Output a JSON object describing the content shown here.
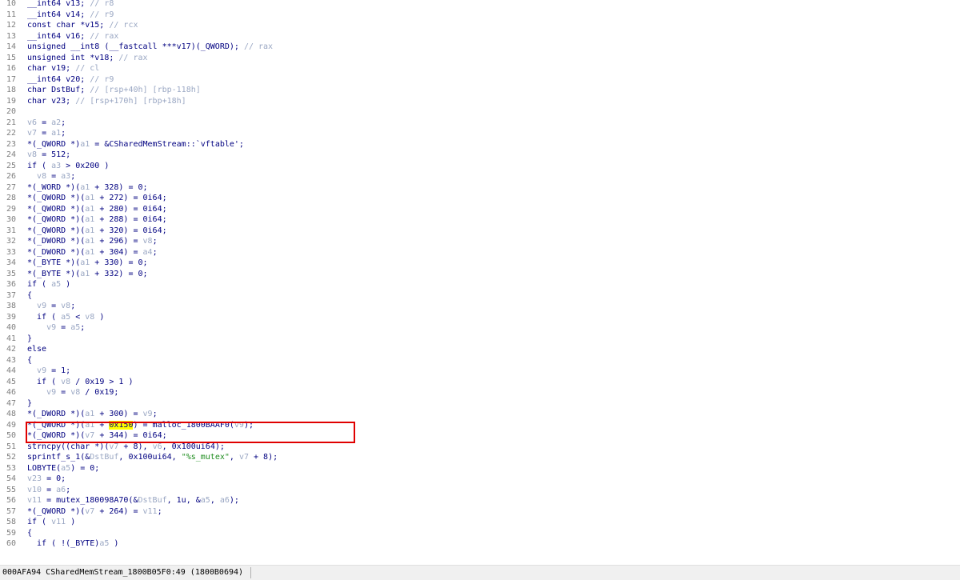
{
  "editor": {
    "lines": [
      {
        "n": "10",
        "segs": [
          [
            "k",
            "__int64 v13; "
          ],
          [
            "c",
            "// r8"
          ]
        ]
      },
      {
        "n": "11",
        "segs": [
          [
            "k",
            "__int64 v14; "
          ],
          [
            "c",
            "// r9"
          ]
        ]
      },
      {
        "n": "12",
        "segs": [
          [
            "k",
            "const char *v15; "
          ],
          [
            "c",
            "// rcx"
          ]
        ]
      },
      {
        "n": "13",
        "segs": [
          [
            "k",
            "__int64 v16; "
          ],
          [
            "c",
            "// rax"
          ]
        ]
      },
      {
        "n": "14",
        "segs": [
          [
            "k",
            "unsigned __int8 (__fastcall ***v17)(_QWORD); "
          ],
          [
            "c",
            "// rax"
          ]
        ]
      },
      {
        "n": "15",
        "segs": [
          [
            "k",
            "unsigned int *v18; "
          ],
          [
            "c",
            "// rax"
          ]
        ]
      },
      {
        "n": "16",
        "segs": [
          [
            "k",
            "char v19; "
          ],
          [
            "c",
            "// cl"
          ]
        ]
      },
      {
        "n": "17",
        "segs": [
          [
            "k",
            "__int64 v20; "
          ],
          [
            "c",
            "// r9"
          ]
        ]
      },
      {
        "n": "18",
        "segs": [
          [
            "k",
            "char DstBuf; "
          ],
          [
            "c",
            "// [rsp+40h] [rbp-118h]"
          ]
        ]
      },
      {
        "n": "19",
        "segs": [
          [
            "k",
            "char v23; "
          ],
          [
            "c",
            "// [rsp+170h] [rbp+18h]"
          ]
        ]
      },
      {
        "n": "20",
        "segs": []
      },
      {
        "n": "21",
        "segs": [
          [
            "v",
            "v6"
          ],
          [
            "k",
            " = "
          ],
          [
            "v",
            "a2"
          ],
          [
            "k",
            ";"
          ]
        ]
      },
      {
        "n": "22",
        "segs": [
          [
            "v",
            "v7"
          ],
          [
            "k",
            " = "
          ],
          [
            "v",
            "a1"
          ],
          [
            "k",
            ";"
          ]
        ]
      },
      {
        "n": "23",
        "segs": [
          [
            "k",
            "*(_QWORD *)"
          ],
          [
            "v",
            "a1"
          ],
          [
            "k",
            " = &CSharedMemStream::`vftable';"
          ]
        ]
      },
      {
        "n": "24",
        "segs": [
          [
            "v",
            "v8"
          ],
          [
            "k",
            " = 512;"
          ]
        ]
      },
      {
        "n": "25",
        "segs": [
          [
            "k",
            "if ( "
          ],
          [
            "v",
            "a3"
          ],
          [
            "k",
            " > 0x200 )"
          ]
        ]
      },
      {
        "n": "26",
        "segs": [
          [
            "k",
            "  "
          ],
          [
            "v",
            "v8"
          ],
          [
            "k",
            " = "
          ],
          [
            "v",
            "a3"
          ],
          [
            "k",
            ";"
          ]
        ]
      },
      {
        "n": "27",
        "segs": [
          [
            "k",
            "*(_WORD *)("
          ],
          [
            "v",
            "a1"
          ],
          [
            "k",
            " + 328) = 0;"
          ]
        ]
      },
      {
        "n": "28",
        "segs": [
          [
            "k",
            "*(_QWORD *)("
          ],
          [
            "v",
            "a1"
          ],
          [
            "k",
            " + 272) = 0i64;"
          ]
        ]
      },
      {
        "n": "29",
        "segs": [
          [
            "k",
            "*(_QWORD *)("
          ],
          [
            "v",
            "a1"
          ],
          [
            "k",
            " + 280) = 0i64;"
          ]
        ]
      },
      {
        "n": "30",
        "segs": [
          [
            "k",
            "*(_QWORD *)("
          ],
          [
            "v",
            "a1"
          ],
          [
            "k",
            " + 288) = 0i64;"
          ]
        ]
      },
      {
        "n": "31",
        "segs": [
          [
            "k",
            "*(_QWORD *)("
          ],
          [
            "v",
            "a1"
          ],
          [
            "k",
            " + 320) = 0i64;"
          ]
        ]
      },
      {
        "n": "32",
        "segs": [
          [
            "k",
            "*(_DWORD *)("
          ],
          [
            "v",
            "a1"
          ],
          [
            "k",
            " + 296) = "
          ],
          [
            "v",
            "v8"
          ],
          [
            "k",
            ";"
          ]
        ]
      },
      {
        "n": "33",
        "segs": [
          [
            "k",
            "*(_DWORD *)("
          ],
          [
            "v",
            "a1"
          ],
          [
            "k",
            " + 304) = "
          ],
          [
            "v",
            "a4"
          ],
          [
            "k",
            ";"
          ]
        ]
      },
      {
        "n": "34",
        "segs": [
          [
            "k",
            "*(_BYTE *)("
          ],
          [
            "v",
            "a1"
          ],
          [
            "k",
            " + 330) = 0;"
          ]
        ]
      },
      {
        "n": "35",
        "segs": [
          [
            "k",
            "*(_BYTE *)("
          ],
          [
            "v",
            "a1"
          ],
          [
            "k",
            " + 332) = 0;"
          ]
        ]
      },
      {
        "n": "36",
        "segs": [
          [
            "k",
            "if ( "
          ],
          [
            "v",
            "a5"
          ],
          [
            "k",
            " )"
          ]
        ]
      },
      {
        "n": "37",
        "segs": [
          [
            "k",
            "{"
          ]
        ]
      },
      {
        "n": "38",
        "segs": [
          [
            "k",
            "  "
          ],
          [
            "v",
            "v9"
          ],
          [
            "k",
            " = "
          ],
          [
            "v",
            "v8"
          ],
          [
            "k",
            ";"
          ]
        ]
      },
      {
        "n": "39",
        "segs": [
          [
            "k",
            "  if ( "
          ],
          [
            "v",
            "a5"
          ],
          [
            "k",
            " < "
          ],
          [
            "v",
            "v8"
          ],
          [
            "k",
            " )"
          ]
        ]
      },
      {
        "n": "40",
        "segs": [
          [
            "k",
            "    "
          ],
          [
            "v",
            "v9"
          ],
          [
            "k",
            " = "
          ],
          [
            "v",
            "a5"
          ],
          [
            "k",
            ";"
          ]
        ]
      },
      {
        "n": "41",
        "segs": [
          [
            "k",
            "}"
          ]
        ]
      },
      {
        "n": "42",
        "segs": [
          [
            "k",
            "else"
          ]
        ]
      },
      {
        "n": "43",
        "segs": [
          [
            "k",
            "{"
          ]
        ]
      },
      {
        "n": "44",
        "segs": [
          [
            "k",
            "  "
          ],
          [
            "v",
            "v9"
          ],
          [
            "k",
            " = 1;"
          ]
        ]
      },
      {
        "n": "45",
        "segs": [
          [
            "k",
            "  if ( "
          ],
          [
            "v",
            "v8"
          ],
          [
            "k",
            " / 0x19 > 1 )"
          ]
        ]
      },
      {
        "n": "46",
        "segs": [
          [
            "k",
            "    "
          ],
          [
            "v",
            "v9"
          ],
          [
            "k",
            " = "
          ],
          [
            "v",
            "v8"
          ],
          [
            "k",
            " / 0x19;"
          ]
        ]
      },
      {
        "n": "47",
        "segs": [
          [
            "k",
            "}"
          ]
        ]
      },
      {
        "n": "48",
        "segs": [
          [
            "k",
            "*(_DWORD *)("
          ],
          [
            "v",
            "a1"
          ],
          [
            "k",
            " + 300) = "
          ],
          [
            "v",
            "v9"
          ],
          [
            "k",
            ";"
          ]
        ]
      },
      {
        "n": "49",
        "segs": [
          [
            "k",
            "*(_QWORD *)("
          ],
          [
            "v",
            "a1"
          ],
          [
            "k",
            " + "
          ],
          [
            "h",
            "0x150"
          ],
          [
            "k",
            ") = malloc_1800BAAF0("
          ],
          [
            "v",
            "v9"
          ],
          [
            "k",
            ");"
          ]
        ]
      },
      {
        "n": "50",
        "segs": [
          [
            "k",
            "*(_QWORD *)("
          ],
          [
            "v",
            "v7"
          ],
          [
            "k",
            " + 344) = 0i64;"
          ]
        ]
      },
      {
        "n": "51",
        "segs": [
          [
            "k",
            "strncpy((char *)("
          ],
          [
            "v",
            "v7"
          ],
          [
            "k",
            " + 8), "
          ],
          [
            "v",
            "v6"
          ],
          [
            "k",
            ", 0x100ui64);"
          ]
        ]
      },
      {
        "n": "52",
        "segs": [
          [
            "k",
            "sprintf_s_1(&"
          ],
          [
            "v",
            "DstBuf"
          ],
          [
            "k",
            ", 0x100ui64, "
          ],
          [
            "s",
            "\"%s_mutex\""
          ],
          [
            "k",
            ", "
          ],
          [
            "v",
            "v7"
          ],
          [
            "k",
            " + 8);"
          ]
        ]
      },
      {
        "n": "53",
        "segs": [
          [
            "k",
            "LOBYTE("
          ],
          [
            "v",
            "a5"
          ],
          [
            "k",
            ") = 0;"
          ]
        ]
      },
      {
        "n": "54",
        "segs": [
          [
            "v",
            "v23"
          ],
          [
            "k",
            " = 0;"
          ]
        ]
      },
      {
        "n": "55",
        "segs": [
          [
            "v",
            "v10"
          ],
          [
            "k",
            " = "
          ],
          [
            "v",
            "a6"
          ],
          [
            "k",
            ";"
          ]
        ]
      },
      {
        "n": "56",
        "segs": [
          [
            "v",
            "v11"
          ],
          [
            "k",
            " = mutex_180098A70(&"
          ],
          [
            "v",
            "DstBuf"
          ],
          [
            "k",
            ", 1u, &"
          ],
          [
            "v",
            "a5"
          ],
          [
            "k",
            ", "
          ],
          [
            "v",
            "a6"
          ],
          [
            "k",
            ");"
          ]
        ]
      },
      {
        "n": "57",
        "segs": [
          [
            "k",
            "*(_QWORD *)("
          ],
          [
            "v",
            "v7"
          ],
          [
            "k",
            " + 264) = "
          ],
          [
            "v",
            "v11"
          ],
          [
            "k",
            ";"
          ]
        ]
      },
      {
        "n": "58",
        "segs": [
          [
            "k",
            "if ( "
          ],
          [
            "v",
            "v11"
          ],
          [
            "k",
            " )"
          ]
        ]
      },
      {
        "n": "59",
        "segs": [
          [
            "k",
            "{"
          ]
        ]
      },
      {
        "n": "60",
        "segs": [
          [
            "k",
            "  if ( !(_BYTE)"
          ],
          [
            "v",
            "a5"
          ],
          [
            "k",
            " )"
          ]
        ]
      }
    ],
    "highlight_box_line": "49"
  },
  "status_bar": {
    "text": "000AFA94 CSharedMemStream_1800B05F0:49 (1800B0694)"
  },
  "colors": {
    "keyword": "#000080",
    "variable": "#9aa7c3",
    "string": "#1e8c1e",
    "highlight": "#ffff00",
    "box": "#e00000"
  }
}
